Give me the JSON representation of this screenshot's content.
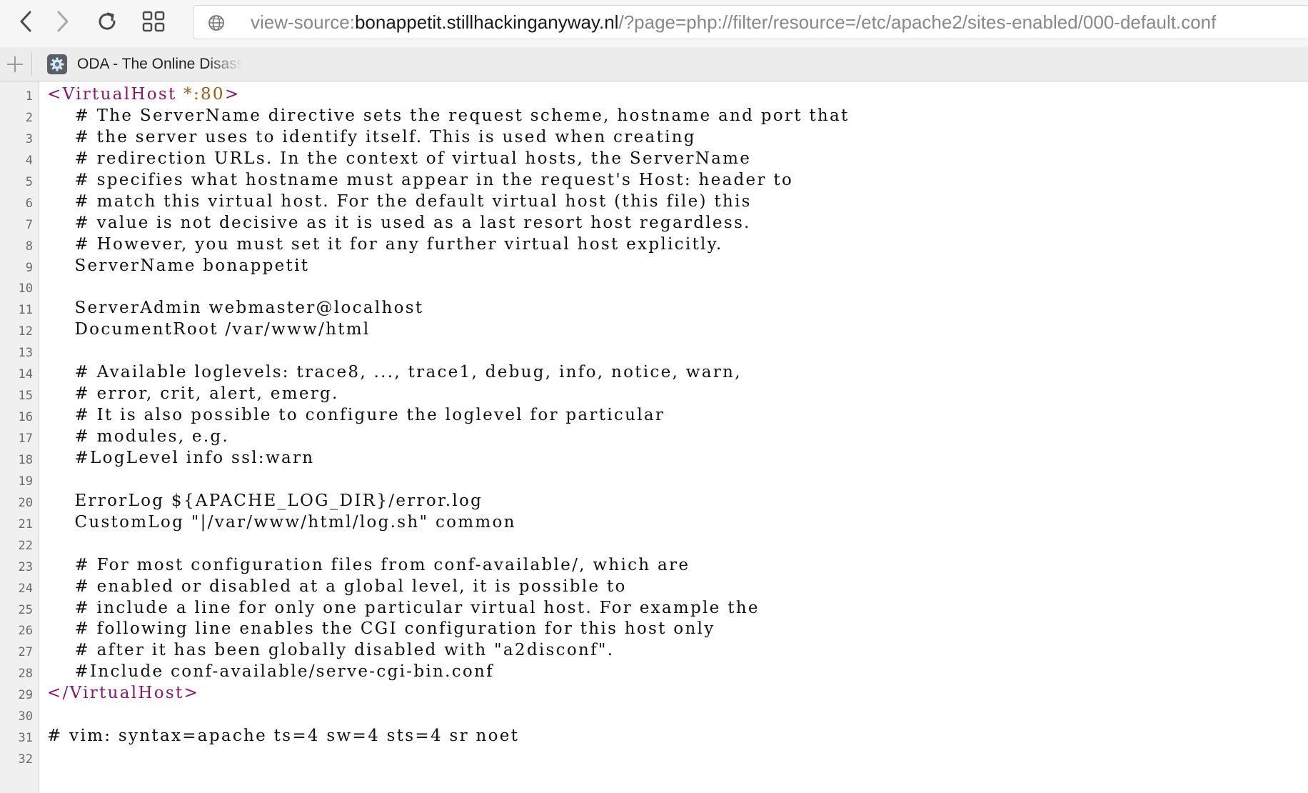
{
  "toolbar": {
    "back_icon": "chevron-left-icon",
    "forward_icon": "chevron-right-icon",
    "reload_icon": "reload-icon",
    "tabs_icon": "grid-icon",
    "url": {
      "prefix": "view-source:",
      "host": "bonappetit.stillhackinganyway.nl",
      "path": "/?page=php://filter/resource=/etc/apache2/sites-enabled/000-default.conf"
    },
    "globe_icon": "globe-icon"
  },
  "bookmarks": {
    "add_icon": "plus-icon",
    "items": [
      {
        "label": "ODA - The Online Disassembler",
        "icon": "gear-icon"
      }
    ]
  },
  "source": {
    "lines": [
      {
        "n": "1",
        "text": "<VirtualHost *:80>",
        "kind": "tag_open",
        "tag": "<VirtualHost",
        "attr": "*:80",
        "close": ">"
      },
      {
        "n": "2",
        "text": "    # The ServerName directive sets the request scheme, hostname and port that"
      },
      {
        "n": "3",
        "text": "    # the server uses to identify itself. This is used when creating"
      },
      {
        "n": "4",
        "text": "    # redirection URLs. In the context of virtual hosts, the ServerName"
      },
      {
        "n": "5",
        "text": "    # specifies what hostname must appear in the request's Host: header to"
      },
      {
        "n": "6",
        "text": "    # match this virtual host. For the default virtual host (this file) this"
      },
      {
        "n": "7",
        "text": "    # value is not decisive as it is used as a last resort host regardless."
      },
      {
        "n": "8",
        "text": "    # However, you must set it for any further virtual host explicitly."
      },
      {
        "n": "9",
        "text": "    ServerName bonappetit"
      },
      {
        "n": "10",
        "text": ""
      },
      {
        "n": "11",
        "text": "    ServerAdmin webmaster@localhost"
      },
      {
        "n": "12",
        "text": "    DocumentRoot /var/www/html"
      },
      {
        "n": "13",
        "text": ""
      },
      {
        "n": "14",
        "text": "    # Available loglevels: trace8, ..., trace1, debug, info, notice, warn,"
      },
      {
        "n": "15",
        "text": "    # error, crit, alert, emerg."
      },
      {
        "n": "16",
        "text": "    # It is also possible to configure the loglevel for particular"
      },
      {
        "n": "17",
        "text": "    # modules, e.g."
      },
      {
        "n": "18",
        "text": "    #LogLevel info ssl:warn"
      },
      {
        "n": "19",
        "text": ""
      },
      {
        "n": "20",
        "text": "    ErrorLog ${APACHE_LOG_DIR}/error.log"
      },
      {
        "n": "21",
        "text": "    CustomLog \"|/var/www/html/log.sh\" common"
      },
      {
        "n": "22",
        "text": ""
      },
      {
        "n": "23",
        "text": "    # For most configuration files from conf-available/, which are"
      },
      {
        "n": "24",
        "text": "    # enabled or disabled at a global level, it is possible to"
      },
      {
        "n": "25",
        "text": "    # include a line for only one particular virtual host. For example the"
      },
      {
        "n": "26",
        "text": "    # following line enables the CGI configuration for this host only"
      },
      {
        "n": "27",
        "text": "    # after it has been globally disabled with \"a2disconf\"."
      },
      {
        "n": "28",
        "text": "    #Include conf-available/serve-cgi-bin.conf"
      },
      {
        "n": "29",
        "text": "</VirtualHost>",
        "kind": "tag"
      },
      {
        "n": "30",
        "text": ""
      },
      {
        "n": "31",
        "text": "# vim: syntax=apache ts=4 sw=4 sts=4 sr noet"
      },
      {
        "n": "32",
        "text": ""
      }
    ]
  },
  "colors": {
    "tag": "#8a1868",
    "attr": "#9a5a12",
    "text": "#111111",
    "line_number": "#6b6b6b",
    "gutter": "#f0f0f0"
  }
}
